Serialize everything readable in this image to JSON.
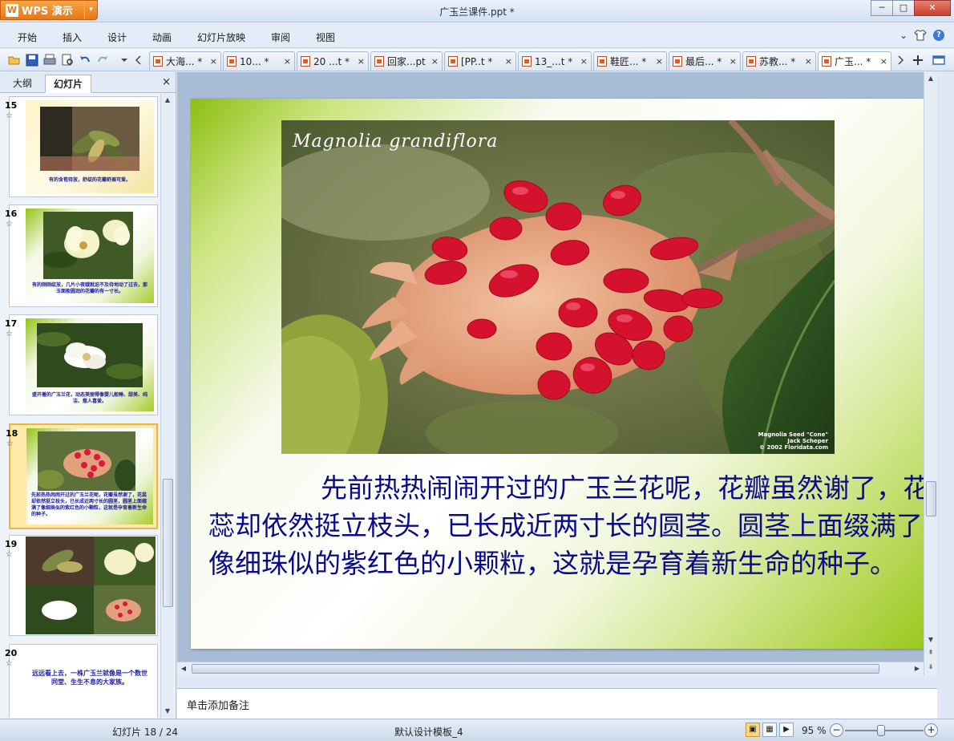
{
  "titlebar": {
    "app_button": "WPS 演示",
    "logo_glyph": "W",
    "arrow": "▾",
    "window_title": "广玉兰课件.ppt *",
    "minimize": "─",
    "maximize": "□",
    "close": "✕"
  },
  "menu": {
    "items": [
      "开始",
      "插入",
      "设计",
      "动画",
      "幻灯片放映",
      "审阅",
      "视图"
    ],
    "right_chevron": "⌄",
    "help": "?"
  },
  "tabs": [
    {
      "label": "大海... *",
      "x": "×"
    },
    {
      "label": "10... *",
      "x": "×"
    },
    {
      "label": "20 ...t *",
      "x": "×"
    },
    {
      "label": "回家...pt",
      "x": "×"
    },
    {
      "label": "[PP..t *",
      "x": "×"
    },
    {
      "label": "13_...t *",
      "x": "×"
    },
    {
      "label": "鞋匠... *",
      "x": "×"
    },
    {
      "label": "最后... *",
      "x": "×"
    },
    {
      "label": "苏教... *",
      "x": "×"
    },
    {
      "label": "广玉... *",
      "x": "×"
    }
  ],
  "left_panel": {
    "tab_outline": "大纲",
    "tab_slides": "幻灯片",
    "close": "×",
    "thumbnails": [
      {
        "num": "15",
        "star": "☆",
        "caption": "有的含苞待放，舒绽的花瓣舒展可爱。"
      },
      {
        "num": "16",
        "star": "☆",
        "caption": "有的刚刚绽放，几片小夜娥就迫不及待地动了过去，那玉面般圆润的花瓣的有一寸长。"
      },
      {
        "num": "17",
        "star": "☆",
        "caption": "盛开着的广玉兰花，动态美丽得像婴儿般睡、甜美、纯洁、惹人喜爱。"
      },
      {
        "num": "18",
        "star": "☆",
        "caption": "先前热热闹闹开过的广玉兰花呢，花瓣虽然谢了，花蕊却依然挺立枝头，已长成近两寸长的圆茎，圆茎上面缀满了像细珠似的紫红色的小颗粒，这就是孕育着新生命的种子。"
      },
      {
        "num": "19",
        "star": "☆",
        "caption": ""
      },
      {
        "num": "20",
        "star": "☆",
        "caption": "远远看上去，一株广玉兰就像是一个数世同堂、生生不息的大家族。"
      }
    ]
  },
  "slide": {
    "photo_title": "Magnolia grandiflora",
    "photo_credit_1": "Magnolia Seed \"Cone\"",
    "photo_credit_2": "Jack Scheper",
    "photo_credit_3": "© 2002 Floridata.com",
    "body_text": "先前热热闹闹开过的广玉兰花呢，花瓣虽然谢了，花蕊却依然挺立枝头，已长成近两寸长的圆茎。圆茎上面缀满了像细珠似的紫红色的小颗粒，这就是孕育着新生命的种子。"
  },
  "notes_placeholder": "单击添加备注",
  "status": {
    "slide_counter": "幻灯片 18 / 24",
    "template": "默认设计模板_4",
    "zoom": "95 %",
    "zoom_minus": "−",
    "zoom_plus": "+"
  },
  "colors": {
    "slide_text": "#0a0a8a",
    "wps_orange": "#e5781a",
    "selected_thumb": "#fde9a8"
  }
}
